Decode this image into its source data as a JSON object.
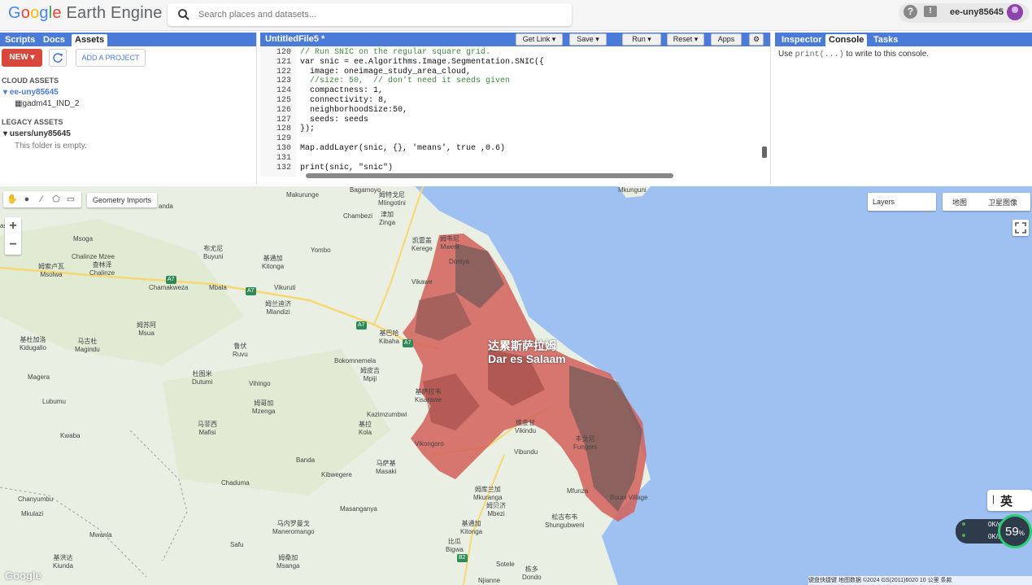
{
  "header": {
    "logo_google": [
      "G",
      "o",
      "o",
      "g",
      "l",
      "e"
    ],
    "logo_suffix": "Earth Engine",
    "search_placeholder": "Search places and datasets...",
    "username": "ee-uny85645"
  },
  "left_panel": {
    "tabs": [
      "Scripts",
      "Docs",
      "Assets"
    ],
    "active_tab": "Assets",
    "new_label": "NEW",
    "add_project_label": "ADD A PROJECT",
    "cloud_assets_heading": "CLOUD ASSETS",
    "cloud_project": "ee-uny85645",
    "cloud_asset_item": "gadm41_IND_2",
    "legacy_heading": "LEGACY ASSETS",
    "legacy_folder": "users/uny85645",
    "legacy_empty": "This folder is empty."
  },
  "editor": {
    "file_title": "UntitledFile5 *",
    "buttons": {
      "get_link": "Get Link",
      "save": "Save",
      "run": "Run",
      "reset": "Reset",
      "apps": "Apps"
    },
    "line_numbers": [
      "120",
      "121",
      "122",
      "123",
      "124",
      "125",
      "126",
      "127",
      "128",
      "129",
      "130",
      "131",
      "132"
    ],
    "lines": [
      "// Run SNIC on the regular square grid.",
      "var snic = ee.Algorithms.Image.Segmentation.SNIC({",
      "  image: oneimage_study_area_cloud,",
      "  //size: 50,  // don't need it seeds given",
      "  compactness: 1,",
      "  connectivity: 8,",
      "  neighborhoodSize:50,",
      "  seeds: seeds",
      "});",
      "",
      "Map.addLayer(snic, {}, 'means', true ,0.6)",
      "",
      "print(snic, \"snic\")"
    ]
  },
  "console": {
    "tabs": [
      "Inspector",
      "Console",
      "Tasks"
    ],
    "active_tab": "Console",
    "message_prefix": "Use ",
    "message_code": "print(...)",
    "message_suffix": " to write to this console."
  },
  "map": {
    "geometry_imports_label": "Geometry Imports",
    "layers_label": "Layers",
    "map_type_options": [
      "地图",
      "卫星图像"
    ],
    "zoom_in": "+",
    "zoom_out": "−",
    "main_city_zh": "达累斯萨拉姆",
    "main_city_en": "Dar es Salaam",
    "places": [
      {
        "zh": "",
        "en": "Makurunge"
      },
      {
        "zh": "姆特戈尼",
        "en": "Mlingotini"
      },
      {
        "zh": "",
        "en": "Bagamoyo"
      },
      {
        "zh": "津加",
        "en": "Zinga"
      },
      {
        "zh": "",
        "en": "Chambezi"
      },
      {
        "zh": "",
        "en": "Mkunguni"
      },
      {
        "zh": "",
        "en": "anda"
      },
      {
        "zh": "",
        "en": "asa"
      },
      {
        "zh": "",
        "en": "Msoga"
      },
      {
        "zh": "布尤尼",
        "en": "Buyuni"
      },
      {
        "zh": "",
        "en": "Yombo"
      },
      {
        "zh": "凯雷盖",
        "en": "Kerege"
      },
      {
        "zh": "姆韦尼",
        "en": "Mweni"
      },
      {
        "zh": "",
        "en": "Doniya"
      },
      {
        "zh": "基通加",
        "en": "Kitonga"
      },
      {
        "zh": "",
        "en": "Chalinze Mzee"
      },
      {
        "zh": "查林泽",
        "en": "Chalinze"
      },
      {
        "zh": "姆索卢瓦",
        "en": "Msolwa"
      },
      {
        "zh": "",
        "en": "Chamakweza"
      },
      {
        "zh": "",
        "en": "Mbala"
      },
      {
        "zh": "",
        "en": "Vikuruti"
      },
      {
        "zh": "",
        "en": "Vikawe"
      },
      {
        "zh": "姆兰迪济",
        "en": "Mlandizi"
      },
      {
        "zh": "姆苏阿",
        "en": "Msua"
      },
      {
        "zh": "基巴哈",
        "en": "Kibaha"
      },
      {
        "zh": "基杜加洛",
        "en": "Kidugallo"
      },
      {
        "zh": "马古杜",
        "en": "Magindu"
      },
      {
        "zh": "鲁伏",
        "en": "Ruvu"
      },
      {
        "zh": "",
        "en": "Bokomnemela"
      },
      {
        "zh": "姆皮吉",
        "en": "Mpiji"
      },
      {
        "zh": "",
        "en": "Magera"
      },
      {
        "zh": "杜图米",
        "en": "Dutumi"
      },
      {
        "zh": "",
        "en": "Vihingo"
      },
      {
        "zh": "基萨拉韦",
        "en": "Kisarawe"
      },
      {
        "zh": "姆哥加",
        "en": "Mzenga"
      },
      {
        "zh": "",
        "en": "Lubumu"
      },
      {
        "zh": "",
        "en": "Kazimzumbwi"
      },
      {
        "zh": "基拉",
        "en": "Kola"
      },
      {
        "zh": "维金甘",
        "en": "Vikindu"
      },
      {
        "zh": "",
        "en": "Kwaba"
      },
      {
        "zh": "马菲西",
        "en": "Mafisi"
      },
      {
        "zh": "",
        "en": "Vikongoro"
      },
      {
        "zh": "",
        "en": "Vibundu"
      },
      {
        "zh": "丰戈尼",
        "en": "Fungoni"
      },
      {
        "zh": "",
        "en": "Banda"
      },
      {
        "zh": "马萨基",
        "en": "Masaki"
      },
      {
        "zh": "",
        "en": "Kibwegere"
      },
      {
        "zh": "",
        "en": "Chaduma"
      },
      {
        "zh": "",
        "en": "Mfunza"
      },
      {
        "zh": "",
        "en": "Buuni Village"
      },
      {
        "zh": "姆库兰加",
        "en": "Mkuranga"
      },
      {
        "zh": "姆贝济",
        "en": "Mbezi"
      },
      {
        "zh": "",
        "en": "Chanyumbu"
      },
      {
        "zh": "",
        "en": "Mkulazi"
      },
      {
        "zh": "",
        "en": "Masanganya"
      },
      {
        "zh": "松古布韦",
        "en": "Shungubweni"
      },
      {
        "zh": "",
        "en": "Mwanla"
      },
      {
        "zh": "马内罗曼戈",
        "en": "Maneromango"
      },
      {
        "zh": "基通加",
        "en": "Kitonga"
      },
      {
        "zh": "",
        "en": "Safu"
      },
      {
        "zh": "比瓜",
        "en": "Bigwa"
      },
      {
        "zh": "基洪达",
        "en": "Kiunda"
      },
      {
        "zh": "",
        "en": "Sotele"
      },
      {
        "zh": "姆桑加",
        "en": "Msanga"
      },
      {
        "zh": "栋多",
        "en": "Dondo"
      },
      {
        "zh": "",
        "en": "Njianne"
      }
    ],
    "road_labels": [
      "A7",
      "A7",
      "A7",
      "A7",
      "B2"
    ],
    "google_watermark": "Google",
    "attribution": "键盘快捷键   地图数据 ©2024 GS(2011)6020   10 公里          条款",
    "ime_label": "英",
    "speed_up": "0K/s",
    "speed_down": "0K/s",
    "speed_percent": "59",
    "speed_percent_unit": "%"
  }
}
